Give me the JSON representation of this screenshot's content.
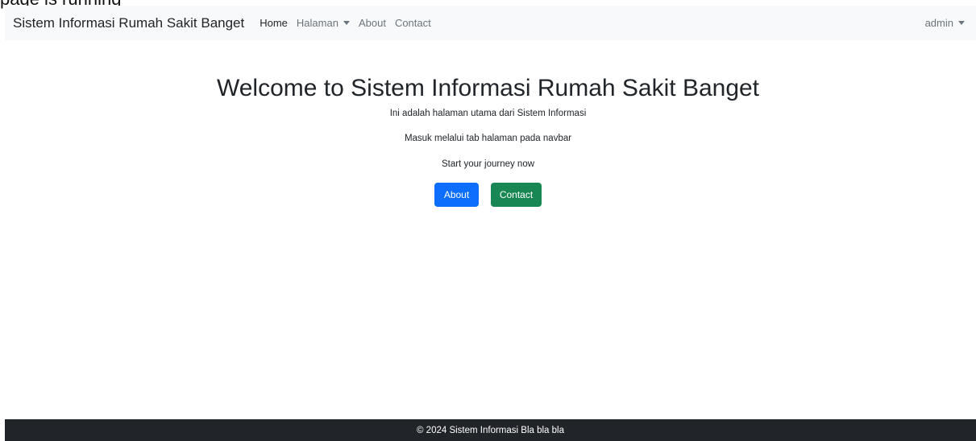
{
  "top_clipped_text": "page is running",
  "navbar": {
    "brand": "Sistem Informasi Rumah Sakit Banget",
    "links": [
      {
        "label": "Home"
      },
      {
        "label": "Halaman"
      },
      {
        "label": "About"
      },
      {
        "label": "Contact"
      }
    ],
    "user": "admin"
  },
  "hero": {
    "title": "Welcome to Sistem Informasi Rumah Sakit Banget",
    "lines": [
      "Ini adalah halaman utama dari Sistem Informasi",
      "Masuk melalui tab halaman pada navbar",
      "Start your journey now"
    ],
    "buttons": {
      "about": "About",
      "contact": "Contact"
    }
  },
  "footer": {
    "text": "© 2024 Sistem Informasi Bla bla bla"
  },
  "colors": {
    "navbar_bg": "#f8f9fa",
    "primary": "#0d6efd",
    "success": "#198754",
    "footer_bg": "#212529"
  }
}
